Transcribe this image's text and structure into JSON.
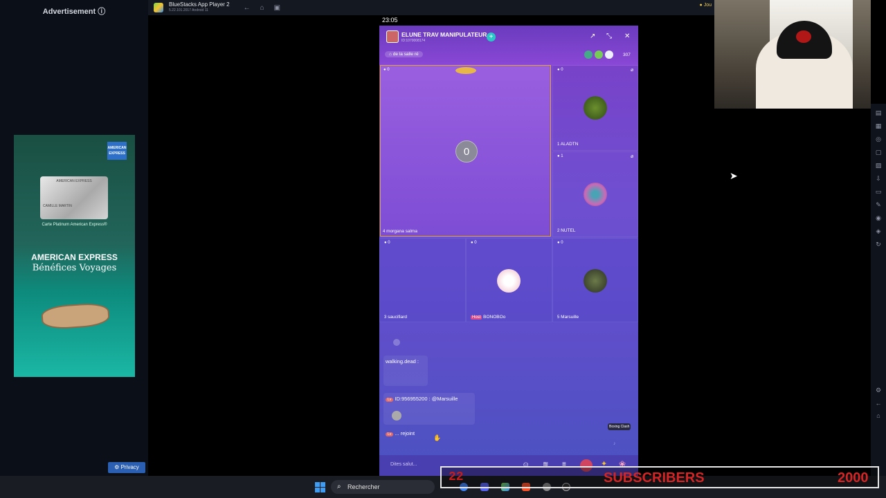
{
  "ad": {
    "label": "Advertisement ⓘ",
    "brand_logo": "AMERICAN EXPRESS",
    "card_text": "AMERICAN EXPRESS",
    "card_holder": "CAMILLE MARTIN",
    "card_caption": "Carte Platinum American Express®",
    "title": "AMERICAN EXPRESS",
    "subtitle": "Bénéfices Voyages",
    "privacy": "Privacy"
  },
  "titlebar": {
    "app_name": "BlueStacks App Player 2",
    "version": "5.22.101.2017  Android 11",
    "right_label": "Jou"
  },
  "phone": {
    "clock": "23:05",
    "room": {
      "name": "ELUNE TRAV MANIPULATEUR",
      "id": "ID:1070008174",
      "tag": "de la salle ré",
      "viewers": "307"
    },
    "seats": [
      {
        "coins": "0",
        "number": "4",
        "name": "morgana salma",
        "big_label": "0"
      },
      {
        "coins": "0",
        "number": "1",
        "name": "ALADTN"
      },
      {
        "coins": "1",
        "number": "2",
        "name": "NUTEL"
      },
      {
        "coins": "0",
        "number": "3",
        "name": "saucifiard"
      },
      {
        "coins": "0",
        "number": "Host",
        "name": "BONOBOo"
      },
      {
        "coins": "0",
        "number": "5",
        "name": "Marsuille"
      }
    ],
    "chat": [
      {
        "user": "walking.dead :"
      },
      {
        "user": "ID:956955200 : @Marsuille"
      },
      {
        "user": "... rejoint"
      }
    ],
    "game_badge": "Boxing Clash",
    "input_placeholder": "Dites salut..."
  },
  "taskbar": {
    "search_placeholder": "Rechercher"
  },
  "overlay": {
    "left_count": "22",
    "label": "SUBSCRIBERS",
    "goal": "2000"
  }
}
